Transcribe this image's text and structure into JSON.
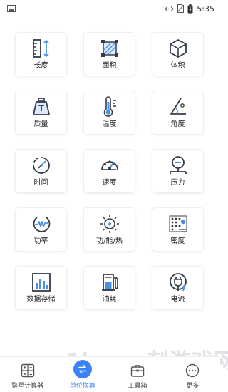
{
  "status_bar": {
    "time": "5:35"
  },
  "tools": [
    {
      "label": "长度",
      "icon": "ruler-icon"
    },
    {
      "label": "面积",
      "icon": "area-icon"
    },
    {
      "label": "体积",
      "icon": "cube-icon"
    },
    {
      "label": "质量",
      "icon": "weight-icon"
    },
    {
      "label": "温度",
      "icon": "thermometer-icon"
    },
    {
      "label": "角度",
      "icon": "angle-icon"
    },
    {
      "label": "时间",
      "icon": "clock-icon"
    },
    {
      "label": "速度",
      "icon": "speedometer-icon"
    },
    {
      "label": "压力",
      "icon": "pressure-gauge-icon"
    },
    {
      "label": "功率",
      "icon": "power-icon"
    },
    {
      "label": "功/能/热",
      "icon": "energy-icon"
    },
    {
      "label": "密度",
      "icon": "density-icon"
    },
    {
      "label": "数据存储",
      "icon": "data-storage-icon"
    },
    {
      "label": "油耗",
      "icon": "fuel-pump-icon"
    },
    {
      "label": "电流",
      "icon": "plug-icon"
    }
  ],
  "bottom_nav": [
    {
      "label": "繁星计算器",
      "icon": "calculator-icon",
      "active": false
    },
    {
      "label": "单位换算",
      "icon": "unit-convert-icon",
      "active": true
    },
    {
      "label": "工具箱",
      "icon": "toolbox-icon",
      "active": false
    },
    {
      "label": "更多",
      "icon": "more-icon",
      "active": false
    }
  ],
  "watermark": {
    "text": "1kxy一刻游戏网",
    "url": "www.1kxy.com"
  },
  "colors": {
    "accent": "#3b82f6",
    "icon_dark": "#333d48",
    "icon_blue": "#4a90e2"
  }
}
